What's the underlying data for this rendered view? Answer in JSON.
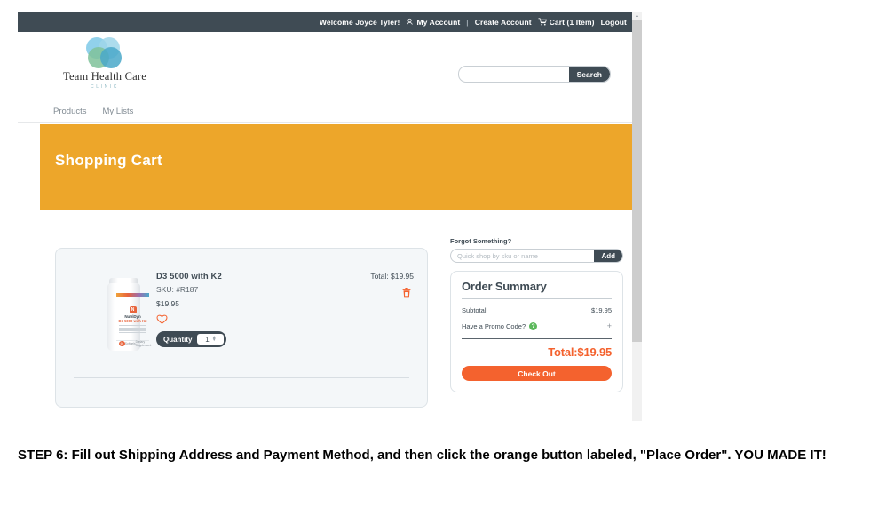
{
  "utility_bar": {
    "welcome": "Welcome Joyce Tyler!",
    "account_icon": "user-icon",
    "my_account": "My Account",
    "separator": "|",
    "create_account": "Create Account",
    "cart_icon": "cart-icon",
    "cart": "Cart (1 Item)",
    "logout": "Logout"
  },
  "header": {
    "logo_name": "Team Health Care",
    "logo_sub": "CLINIC",
    "search": {
      "value": "",
      "placeholder": "",
      "button_label": "Search"
    }
  },
  "nav": {
    "items": [
      {
        "label": "Products"
      },
      {
        "label": "My Lists"
      }
    ]
  },
  "banner": {
    "title": "Shopping Cart",
    "color": "#EDA62A"
  },
  "cart": {
    "item": {
      "name": "D3 5000 with K2",
      "sku": "SKU: #R187",
      "price": "$19.95",
      "total_label": "Total: $19.95",
      "quantity_label": "Quantity",
      "quantity_value": "1",
      "wishlist_icon": "heart-icon",
      "delete_icon": "trash-icon",
      "thumb": {
        "brand": "NutriDyn",
        "brand_badge": "N",
        "product_label": "D3 5000 with K2",
        "count_badge": "60",
        "softgels": "Softgels",
        "supplement": "Dietary Supplement"
      }
    }
  },
  "quick_shop": {
    "label": "Forgot Something?",
    "value": "",
    "placeholder": "Quick shop by sku or name",
    "add_label": "Add"
  },
  "order_summary": {
    "title": "Order Summary",
    "subtotal_label": "Subtotal:",
    "subtotal_value": "$19.95",
    "promo_label": "Have a Promo Code?",
    "promo_help_icon": "question-mark-icon",
    "promo_expand": "+",
    "total": "Total:$19.95",
    "total_color": "#F4622E",
    "checkout_label": "Check Out"
  },
  "scrollbar": {
    "up_arrow": "▲"
  },
  "caption": {
    "text": "STEP 6: Fill out Shipping Address and Payment Method, and then click the orange button labeled, \"Place Order\". YOU MADE IT!"
  }
}
